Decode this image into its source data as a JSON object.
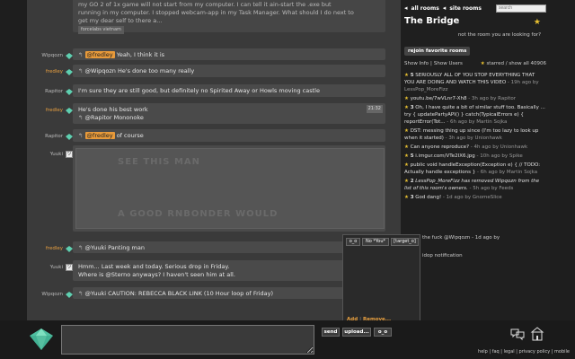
{
  "chat": {
    "top_message": {
      "line1": "my GO 2 of 1x game will not start from my computer. I can tell it ain-start the .exe but",
      "line2": "running in my computer. I stopped webcam-app in my Task Manager. What should I do next to",
      "line3": "get my dear self to there a...",
      "tag": "forcelabs vietnam"
    },
    "messages": [
      {
        "user": "Wipqozn",
        "orange": false,
        "mention": "@fredley",
        "text": " Yeah, I think it is"
      },
      {
        "user": "fredley",
        "orange": true,
        "mention": "",
        "text": "@Wipqozn He's done too many really"
      },
      {
        "user": "Rapitor",
        "orange": false,
        "mention": "",
        "text": "I'm sure they are still good, but definitely no Spirited Away or Howls moving castle"
      },
      {
        "user": "fredley",
        "orange": true,
        "mention": "",
        "text": "He's done his best work",
        "text2": "@Rapitor Mononoke",
        "timestamp": "21:32"
      },
      {
        "user": "Rapitor",
        "orange": false,
        "mention": "@fredley",
        "text": " of course"
      },
      {
        "user": "Yuuki",
        "orange": false,
        "mention": "",
        "text": ""
      },
      {
        "user": "fredley",
        "orange": true,
        "mention": "",
        "text": "@Yuuki Panting man"
      },
      {
        "user": "Yuuki",
        "orange": false,
        "mention": "",
        "text": "Hmm... Last week and today. Serious drop in Friday.",
        "text2": "Where is @Sterno anyways? I haven't seen him at all."
      },
      {
        "user": "Wipqozn",
        "orange": false,
        "mention": "",
        "text": "@Yuuki CAUTION: REBECCA BLACK LINK (10 Hour loop of Friday)"
      }
    ],
    "image_text_top": "SEE THIS MAN",
    "image_text_bottom": "A GOOD RNBONDER WOULD"
  },
  "sidebar": {
    "all_rooms": "all rooms",
    "site_rooms": "site rooms",
    "search_placeholder": "search",
    "room_title": "The Bridge",
    "room_desc": "not the room you are looking for?",
    "rejoin": "rejoin favorite rooms",
    "show_info": "Show Info",
    "show_users": "Show Users",
    "starred_label": "starred / show all 40906",
    "starred": [
      {
        "count": "5",
        "text": "SERIOUSLY ALL OF YOU STOP EVERYTHING THAT YOU ARE DOING AND WATCH THIS VIDEO",
        "meta": " - 19h ago by LessPop_MoreFizz"
      },
      {
        "count": "",
        "text": "youtu.be/7wVLnr7-Xh8",
        "meta": " - 3h ago by Rapitor"
      },
      {
        "count": "3",
        "text": "Oh, I have quite a bit of similar stuff too. Basically ... try { updatePartyAPI() } catch(TypicalErrors e) { reportError(Tot...",
        "meta": " - 6h ago by Martin Sojka"
      },
      {
        "count": "",
        "text": "DST: messing thing up since (I'm too lazy to look up when it started)",
        "meta": " - 3h ago by Unionhawk"
      },
      {
        "count": "",
        "text": "Can anyone reproduce?",
        "meta": " - 4h ago by Unionhawk"
      },
      {
        "count": "5",
        "text": "i.imgur.com/VTe2IX6.jpg",
        "meta": " - 10h ago by Spike"
      },
      {
        "count": "",
        "text": "public void handleException(Exception e) { // TODO: Actually handle exceptions }",
        "meta": " - 6h ago by Martin Sojka"
      },
      {
        "count": "2",
        "text": "LessPop_MoreFizz has removed Wipqozn from the list of this room's owners.",
        "meta": " - 5h ago by Feeds"
      },
      {
        "count": "3",
        "text": "God dang!",
        "meta": " - 1d ago by GnomeSlice"
      }
    ],
    "over1": "the fuck @Wipqozn - 1d ago by",
    "over2": "idop notification"
  },
  "popup": {
    "btn1": "o_o",
    "btn2": "No *You*",
    "btn3": "[target_o]",
    "add": "Add",
    "remove": "Remove..."
  },
  "input": {
    "send": "send",
    "upload": "upload...",
    "extra": "o_o"
  },
  "footer": {
    "links": "help | faq | legal | privacy policy | mobile"
  },
  "colors": {
    "orange": "#e89a3a",
    "star": "#e8c030"
  }
}
